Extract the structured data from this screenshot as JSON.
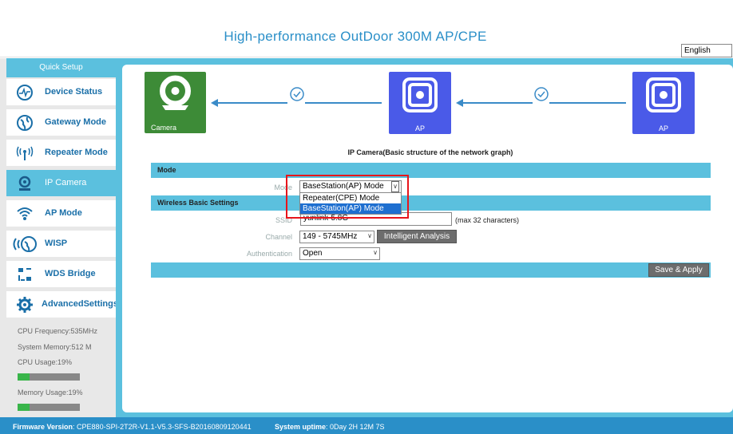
{
  "header": {
    "title": "High-performance OutDoor 300M AP/CPE",
    "language": "English"
  },
  "sidebar": {
    "quick_setup": "Quick Setup",
    "items": [
      {
        "label": "Device Status",
        "icon": "pulse-icon"
      },
      {
        "label": "Gateway Mode",
        "icon": "globe-icon"
      },
      {
        "label": "Repeater Mode",
        "icon": "signal-tower-icon"
      },
      {
        "label": "IP Camera",
        "icon": "camera-icon"
      },
      {
        "label": "AP Mode",
        "icon": "wifi-icon"
      },
      {
        "label": "WISP",
        "icon": "wisp-icon"
      },
      {
        "label": "WDS Bridge",
        "icon": "wds-icon"
      },
      {
        "label": "AdvancedSettings",
        "icon": "gear-icon"
      }
    ],
    "stats": {
      "cpu_frequency": "CPU Frequency:535MHz",
      "system_memory": "System Memory:512 M",
      "cpu_usage": "CPU Usage:19%",
      "cpu_usage_value": 0.19,
      "memory_usage": "Memory Usage:19%",
      "memory_usage_value": 0.19
    }
  },
  "diagram": {
    "nodes": [
      {
        "label": "Camera",
        "color": "#3d8b37"
      },
      {
        "label": "AP",
        "color": "#4a5ae8"
      },
      {
        "label": "AP",
        "color": "#4a5ae8"
      }
    ],
    "caption": "IP Camera(Basic structure of the network graph)"
  },
  "mode_section": {
    "title": "Mode",
    "mode_label": "Mode",
    "mode_value": "BaseStation(AP) Mode",
    "options": [
      "Repeater(CPE) Mode",
      "BaseStation(AP) Mode"
    ]
  },
  "wireless_section": {
    "title": "Wireless Basic Settings",
    "ssid_label": "SSID",
    "ssid_value": "yunlink-5.8G",
    "ssid_hint": "(max 32 characters)",
    "channel_label": "Channel",
    "channel_value": "149 - 5745MHz",
    "intelligent_analysis": "Intelligent Analysis",
    "auth_label": "Authentication",
    "auth_value": "Open"
  },
  "actions": {
    "save_apply": "Save & Apply"
  },
  "footer": {
    "firmware_label": "Firmware Version",
    "firmware_value": ": CPE880-SPI-2T2R-V1.1-V5.3-SFS-B20160809120441",
    "uptime_label": "System uptime",
    "uptime_value": ": 0Day 2H 12M 7S"
  },
  "colors": {
    "accent": "#5bc0de",
    "brand": "#2a8fc8",
    "highlight": "#e8151b"
  }
}
